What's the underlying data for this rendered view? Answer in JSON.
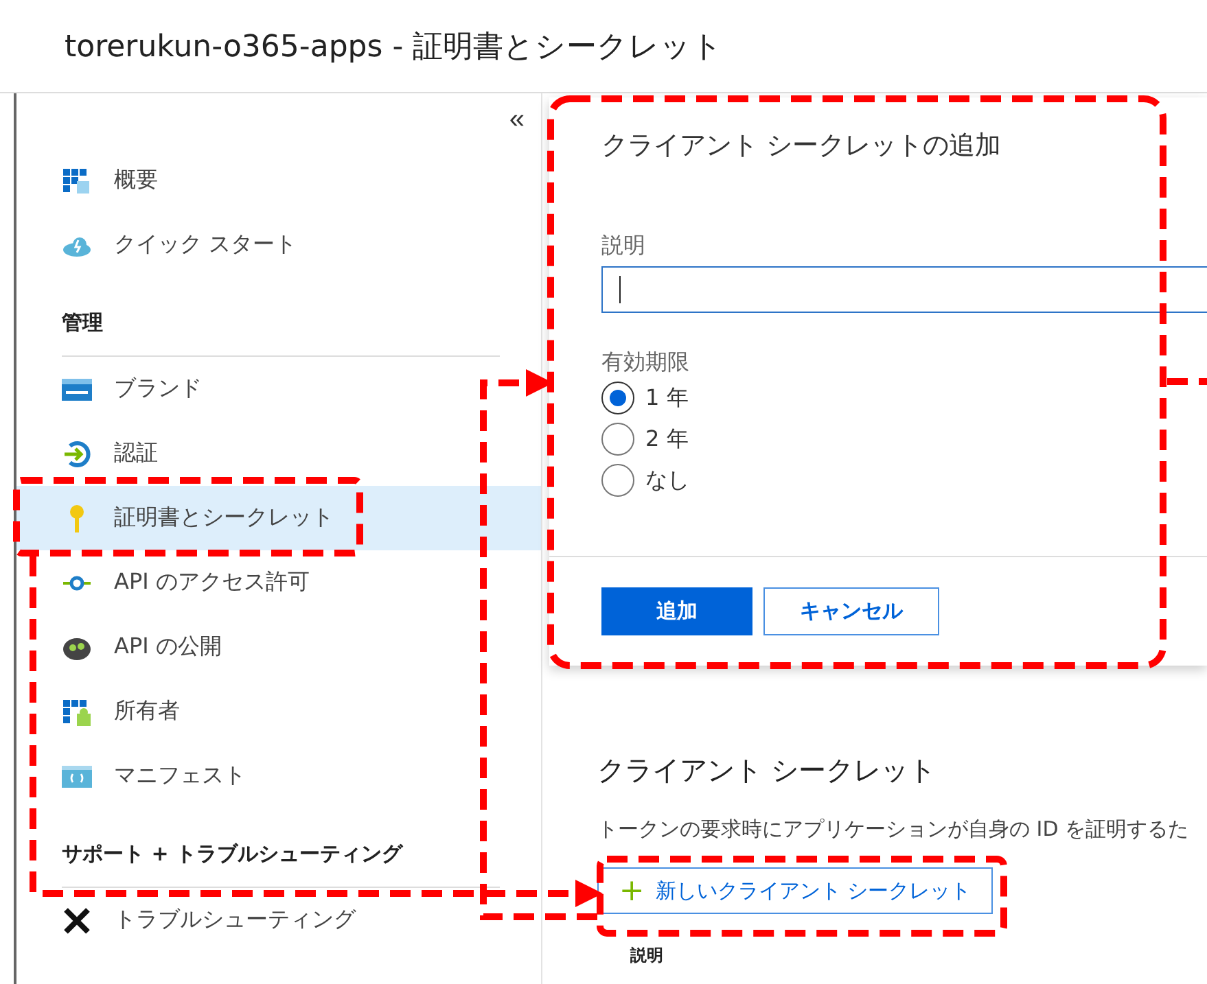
{
  "window": {
    "title": "torerukun-o365-apps - 証明書とシークレット"
  },
  "sidebar": {
    "collapse": "«",
    "entries": [
      {
        "kind": "item",
        "label": "概要",
        "selected": false
      },
      {
        "kind": "item",
        "label": "クイック スタート",
        "selected": false
      },
      {
        "kind": "heading",
        "label": "管理"
      },
      {
        "kind": "item",
        "label": "ブランド",
        "selected": false
      },
      {
        "kind": "item",
        "label": "認証",
        "selected": false
      },
      {
        "kind": "item",
        "label": "証明書とシークレット",
        "selected": true
      },
      {
        "kind": "item",
        "label": "API のアクセス許可",
        "selected": false
      },
      {
        "kind": "item",
        "label": "API の公開",
        "selected": false
      },
      {
        "kind": "item",
        "label": "所有者",
        "selected": false
      },
      {
        "kind": "item",
        "label": "マニフェスト",
        "selected": false
      },
      {
        "kind": "heading",
        "label": "サポート + トラブルシューティング"
      },
      {
        "kind": "item",
        "label": "トラブルシューティング",
        "selected": false
      }
    ]
  },
  "dialog": {
    "title": "クライアント シークレットの追加",
    "description_label": "説明",
    "expiry_label": "有効期限",
    "options": [
      {
        "label": "1 年",
        "selected": true
      },
      {
        "label": "2 年",
        "selected": false
      },
      {
        "label": "なし",
        "selected": false
      }
    ],
    "buttons": [
      {
        "label": "追加",
        "kind": "primary"
      },
      {
        "label": "キャンセル",
        "kind": "secondary"
      }
    ]
  },
  "section": {
    "title": "クライアント シークレット",
    "description": "トークンの要求時にアプリケーションが自身の ID を証明するた",
    "add_button": {
      "icon": "+",
      "label": "新しいクライアント シークレット"
    },
    "column_1": "説明"
  }
}
